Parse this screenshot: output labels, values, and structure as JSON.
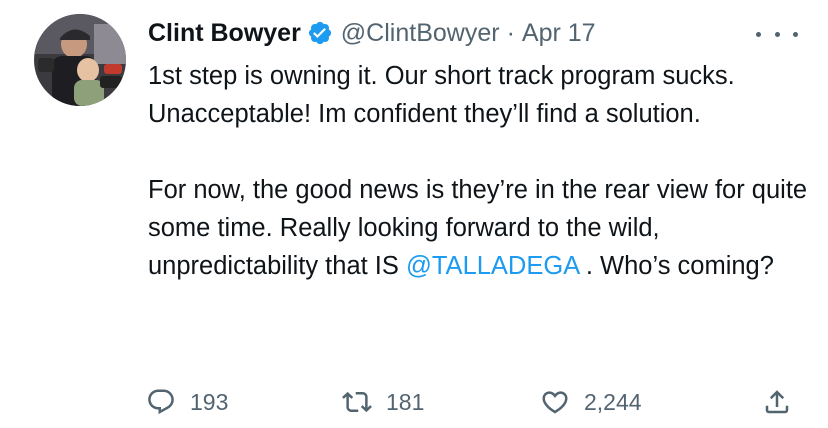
{
  "author": {
    "display_name": "Clint Bowyer",
    "handle": "@ClintBowyer",
    "separator": "·",
    "date": "Apr 17",
    "verified": true
  },
  "tweet": {
    "paragraph1": "1st step is owning it.  Our short track program sucks.  Unacceptable!  Im confident they’ll find a solution.",
    "paragraph2_before": "For now, the good news is they’re in the rear view for quite some time.  Really looking forward to the wild, unpredictability that IS ",
    "mention": "@TALLADEGA",
    "paragraph2_after": " . Who’s coming?"
  },
  "actions": {
    "replies": "193",
    "retweets": "181",
    "likes": "2,244"
  },
  "icons": {
    "reply": "speech-bubble-icon",
    "retweet": "retweet-arrows-icon",
    "like": "heart-icon",
    "share": "share-upload-icon",
    "more": "more-dots-icon",
    "verified": "verified-badge-icon"
  },
  "colors": {
    "text": "#0f1419",
    "secondary": "#536471",
    "link": "#1d9bf0",
    "verified": "#1d9bf0"
  }
}
